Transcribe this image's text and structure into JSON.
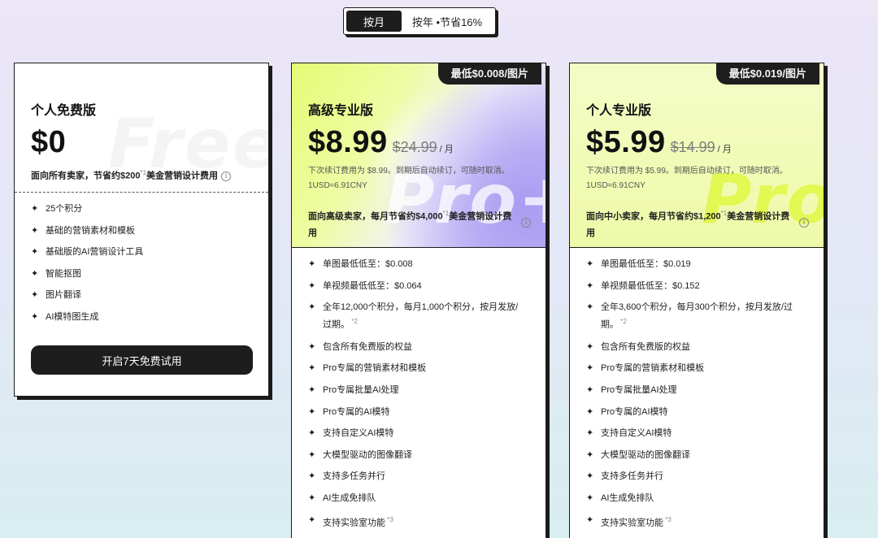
{
  "billing_toggle": {
    "monthly": "按月",
    "yearly": "按年 •节省16%"
  },
  "plans": {
    "free": {
      "name": "个人免费版",
      "price": "$0",
      "watermark": "Free",
      "tagline_text": "面向所有卖家，节省约$200",
      "tagline_sup": "*1",
      "tagline_tail": "美金营销设计费用",
      "features": [
        "25个积分",
        "基础的营销素材和模板",
        "基础版的AI营销设计工具",
        "智能抠图",
        "图片翻译",
        "AI模特图生成"
      ],
      "cta": "开启7天免费试用"
    },
    "proplus": {
      "badge": "最低$0.008/图片",
      "name": "高级专业版",
      "price": "$8.99",
      "price_old": "$24.99",
      "per": "/ 月",
      "renew": "下次续订费用为 $8.99。到期后自动续订，可随时取消。",
      "rate": "1USD≈6.91CNY",
      "watermark": "Pro+",
      "tagline_text": "面向高级卖家，每月节省约$4,000",
      "tagline_sup": "*1",
      "tagline_tail": "美金营销设计费用",
      "features": [
        "单图最低低至：$0.008",
        "单视频最低低至：$0.064",
        "全年12,000个积分，每月1,000个积分，按月发放/过期。",
        "包含所有免费版的权益",
        "Pro专属的营销素材和模板",
        "Pro专属批量AI处理",
        "Pro专属的AI模特",
        "支持自定义AI模特",
        "大模型驱动的图像翻译",
        "支持多任务并行",
        "AI生成免排队",
        "支持实验室功能"
      ],
      "feature_notes": {
        "2": "*2",
        "11": "*3"
      }
    },
    "pro": {
      "badge": "最低$0.019/图片",
      "name": "个人专业版",
      "price": "$5.99",
      "price_old": "$14.99",
      "per": "/ 月",
      "renew": "下次续订费用为 $5.99。到期后自动续订，可随时取消。",
      "rate": "1USD≈6.91CNY",
      "watermark": "Pro",
      "tagline_text": "面向中小卖家，每月节省约$1,200",
      "tagline_sup": "*1",
      "tagline_tail": "美金营销设计费用",
      "features": [
        "单图最低低至：$0.019",
        "单视频最低低至：$0.152",
        "全年3,600个积分，每月300个积分，按月发放/过期。",
        "包含所有免费版的权益",
        "Pro专属的营销素材和模板",
        "Pro专属批量AI处理",
        "Pro专属的AI模特",
        "支持自定义AI模特",
        "大模型驱动的图像翻译",
        "支持多任务并行",
        "AI生成免排队",
        "支持实验室功能"
      ],
      "feature_notes": {
        "2": "*2",
        "11": "*3"
      }
    }
  },
  "icons": {
    "feature_bullet": "sparkle-icon",
    "info": "info-icon"
  },
  "colors": {
    "ink": "#1d1d1d",
    "lime": "#e2f853",
    "lavender": "#a99cf2"
  }
}
